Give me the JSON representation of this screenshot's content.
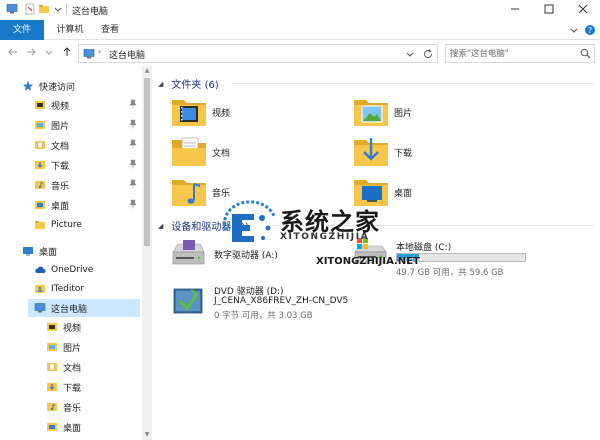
{
  "window": {
    "title": "这台电脑",
    "minimize": "—",
    "maximize": "☐",
    "close": "✕"
  },
  "ribbon": {
    "tabs": [
      "文件",
      "计算机",
      "查看"
    ]
  },
  "address": {
    "path": "这台电脑",
    "search_placeholder": "搜索\"这台电脑\""
  },
  "nav": {
    "quick_access": "快速访问",
    "quick_items": [
      {
        "label": "视频",
        "icon": "video-folder-icon",
        "pinned": true
      },
      {
        "label": "图片",
        "icon": "pictures-folder-icon",
        "pinned": true
      },
      {
        "label": "文档",
        "icon": "documents-folder-icon",
        "pinned": true
      },
      {
        "label": "下载",
        "icon": "downloads-folder-icon",
        "pinned": true
      },
      {
        "label": "音乐",
        "icon": "music-folder-icon",
        "pinned": true
      },
      {
        "label": "桌面",
        "icon": "desktop-folder-icon",
        "pinned": true
      },
      {
        "label": "Picture",
        "icon": "folder-icon",
        "pinned": false
      }
    ],
    "desktop": "桌面",
    "onedrive": "OneDrive",
    "iteditor": "ITeditor",
    "this_pc": "这台电脑",
    "pc_items": [
      "视频",
      "图片",
      "文档",
      "下载",
      "音乐",
      "桌面"
    ]
  },
  "content": {
    "folders_header": "文件夹 (6)",
    "folders": [
      {
        "label": "视频",
        "icon": "video-folder-icon"
      },
      {
        "label": "图片",
        "icon": "pictures-folder-icon"
      },
      {
        "label": "文档",
        "icon": "documents-folder-icon"
      },
      {
        "label": "下载",
        "icon": "downloads-folder-icon"
      },
      {
        "label": "音乐",
        "icon": "music-folder-icon"
      },
      {
        "label": "桌面",
        "icon": "desktop-folder-icon"
      }
    ],
    "drives_header": "设备和驱动器 (3)",
    "drives": [
      {
        "name": "数字驱动器 (A:)",
        "icon": "floppy-drive-icon"
      },
      {
        "name": "本地磁盘 (C:)",
        "icon": "local-disk-icon",
        "free": "49.7 GB 可用，共 59.6 GB",
        "used_fraction": 0.17
      },
      {
        "name": "DVD 驱动器 (D:)",
        "label": "J_CENA_X86FREV_ZH-CN_DV5",
        "icon": "dvd-drive-icon",
        "free": "0 字节 可用，共 3.03 GB"
      }
    ]
  },
  "watermark": {
    "title": "系统之家",
    "subtitle": "XITONGZHIJIA",
    "url": "XITONGZHIJIA.NET"
  },
  "colors": {
    "accent": "#1979ca",
    "selection": "#cce8ff",
    "header_text": "#1e3287",
    "folder_yellow": "#f8c64a",
    "capacity_fill": "#26a0da"
  }
}
